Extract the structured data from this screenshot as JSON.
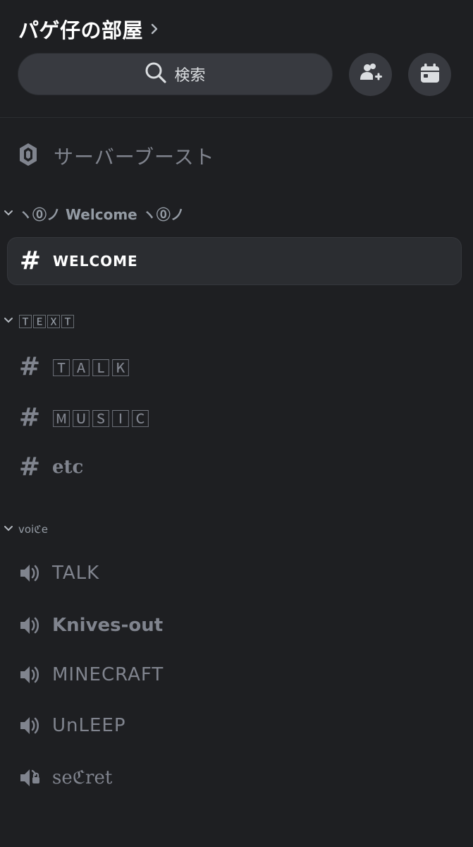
{
  "header": {
    "server_name": "パゲ仔の部屋",
    "search_label": "検索"
  },
  "boost": {
    "label": "サーバーブースト"
  },
  "categories": [
    {
      "label": "ヽ⓪ノ Welcome ヽ⓪ノ"
    },
    {
      "label": "🅃🄴🅇🅃"
    },
    {
      "label": "voiℭe"
    }
  ],
  "channels": {
    "welcome": {
      "label": "WELCOME",
      "selected": true
    },
    "talk": {
      "label": "🅃🄰🄻🄺"
    },
    "music": {
      "label": "🄼🅄🅂🄸🄲"
    },
    "etc": {
      "label": "etc"
    }
  },
  "voice_channels": [
    {
      "label": "TALK"
    },
    {
      "label": "Knives-out"
    },
    {
      "label": "MINECRAFT"
    },
    {
      "label": "ՍnLEEP"
    },
    {
      "label": "seℭret"
    }
  ],
  "colors": {
    "background": "#1e1f22",
    "surface": "#383a40",
    "selected": "#2b2d31",
    "muted_text": "#80848e",
    "bright_text": "#ffffff"
  },
  "icons": {
    "search": "search-icon",
    "invite": "add-member-icon",
    "events": "calendar-icon",
    "boost": "boost-gem-icon",
    "text_channel": "hash-icon",
    "voice_channel": "speaker-icon",
    "locked_voice": "locked-speaker-icon",
    "collapse": "chevron-down-icon",
    "open": "chevron-right-icon"
  }
}
